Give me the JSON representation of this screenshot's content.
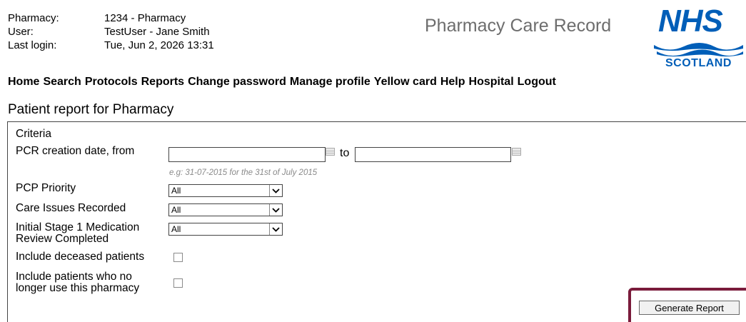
{
  "header": {
    "info": [
      {
        "label": "Pharmacy:",
        "value": "1234 - Pharmacy"
      },
      {
        "label": "User:",
        "value": "TestUser - Jane Smith"
      },
      {
        "label": "Last login:",
        "value": "Tue, Jun 2, 2026 13:31"
      }
    ],
    "app_title": "Pharmacy Care Record",
    "logo": {
      "top": "NHS",
      "bottom": "SCOTLAND",
      "color": "#005eb8"
    }
  },
  "nav": {
    "items": [
      "Home",
      "Search",
      "Protocols",
      "Reports",
      "Change password",
      "Manage profile",
      "Yellow card",
      "Help",
      "Hospital",
      "Logout"
    ]
  },
  "page": {
    "title": "Patient report for Pharmacy"
  },
  "form": {
    "criteria_heading": "Criteria",
    "date_label": "PCR creation date, from",
    "date_from": "",
    "date_to_label": "to",
    "date_to": "",
    "date_hint": "e.g: 31-07-2015 for the 31st of July 2015",
    "calendar_icon": "calendar-icon",
    "pcp_priority": {
      "label": "PCP Priority",
      "value": "All"
    },
    "care_issues": {
      "label": "Care Issues Recorded",
      "value": "All"
    },
    "medication_review": {
      "label_line1": "Initial Stage 1 Medication",
      "label_line2": "Review Completed",
      "value": "All"
    },
    "include_deceased": {
      "label": "Include deceased patients",
      "checked": false
    },
    "include_former": {
      "label_line1": "Include patients who no",
      "label_line2": "longer use this pharmacy",
      "checked": false
    },
    "submit_label": "Generate Report",
    "highlight_color": "#7a1b3b"
  }
}
